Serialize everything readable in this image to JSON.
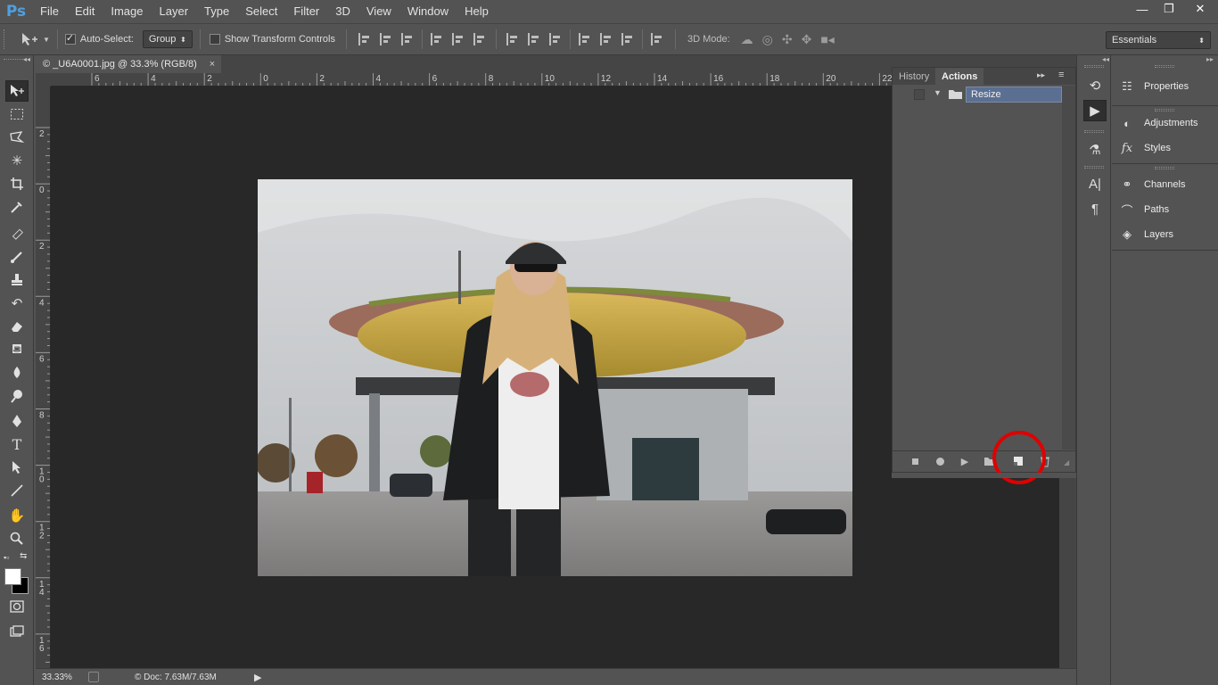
{
  "app": {
    "logo": "Ps"
  },
  "menu": [
    "File",
    "Edit",
    "Image",
    "Layer",
    "Type",
    "Select",
    "Filter",
    "3D",
    "View",
    "Window",
    "Help"
  ],
  "window_buttons": {
    "minimize": "—",
    "restore": "❐",
    "close": "✕"
  },
  "options_bar": {
    "auto_select_label": "Auto-Select:",
    "auto_select_checked": true,
    "auto_select_mode": "Group",
    "show_transform_label": "Show Transform Controls",
    "show_transform_checked": false,
    "mode_3d_label": "3D Mode:",
    "workspace": "Essentials"
  },
  "document": {
    "tab_title": "© _U6A0001.jpg @ 33.3% (RGB/8)",
    "close_glyph": "×",
    "zoom": "33.33%",
    "doc_info": "© Doc: 7.63M/7.63M"
  },
  "rulers": {
    "top": [
      "6",
      "4",
      "2",
      "0",
      "2",
      "4",
      "6",
      "8",
      "10",
      "12",
      "14",
      "16",
      "18",
      "20",
      "22"
    ],
    "left": [
      "2",
      "0",
      "2",
      "4",
      "6",
      "8",
      "1 0",
      "1 2",
      "1 4",
      "1 6"
    ]
  },
  "actions_panel": {
    "tabs": [
      "History",
      "Actions"
    ],
    "active_tab": "Actions",
    "collapse_glyph": "▸▸",
    "menu_glyph": "≡",
    "set_name": "Resize",
    "footer_buttons": [
      "stop-icon",
      "record-icon",
      "play-icon",
      "new-set-icon",
      "new-action-icon",
      "delete-icon"
    ],
    "highlight_color": "#e00000"
  },
  "icon_strip": [
    "history-icon",
    "actions-icon",
    "brush-presets-icon",
    "character-icon",
    "paragraph-icon"
  ],
  "right_panel": {
    "groups": [
      [
        "Properties"
      ],
      [
        "Adjustments",
        "Styles"
      ],
      [
        "Channels",
        "Paths",
        "Layers"
      ]
    ]
  },
  "colors": {
    "accent": "#4f9fe0",
    "selection": "#5a6f91",
    "canvas": "#282828",
    "chrome": "#535353"
  }
}
